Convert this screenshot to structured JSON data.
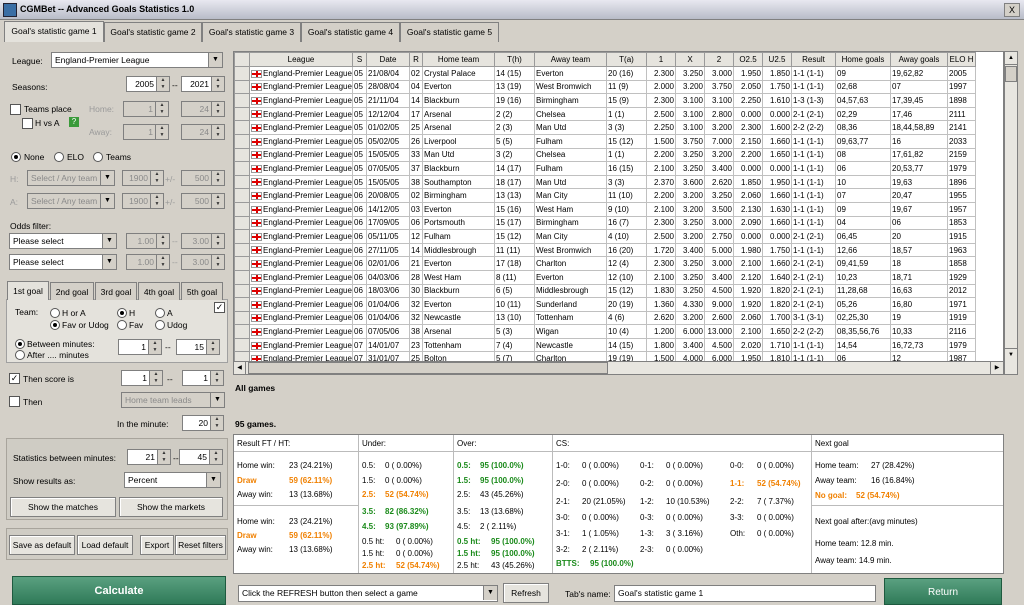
{
  "window": {
    "title": "CGMBet  -- Advanced Goals Statistics 1.0",
    "close_label": "X"
  },
  "tabs": [
    "Goal's statistic game 1",
    "Goal's statistic game 2",
    "Goal's statistic game 3",
    "Goal's statistic game 4",
    "Goal's statistic game 5"
  ],
  "left": {
    "league_label": "League:",
    "league_value": "England-Premier League",
    "seasons_label": "Seasons:",
    "season_from": "2005",
    "season_to": "2021",
    "dash": "--",
    "teams_place_label": "Teams place",
    "hvsa_label": "H vs A",
    "help_label": "?",
    "home_label": "Home:",
    "away_label": "Away:",
    "home_from": "1",
    "home_to": "24",
    "away_from": "1",
    "away_to": "24",
    "rating_none": "None",
    "rating_elo": "ELO",
    "rating_teams": "Teams",
    "h_label": "H:",
    "a_label": "A:",
    "team_placeholder": "Select / Any team",
    "elo_h": "1900",
    "elo_h_pm": "500",
    "elo_a": "1900",
    "elo_a_pm": "500",
    "pm": "+/-",
    "odds_label": "Odds filter:",
    "odds_select1": "Please select",
    "odds_select2": "Please select",
    "odds1_from": "1.00",
    "odds1_to": "3.00",
    "odds2_from": "1.00",
    "odds2_to": "3.00",
    "goal_tabs": [
      "1st goal",
      "2nd goal",
      "3rd goal",
      "4th goal",
      "5th goal"
    ],
    "team_label": "Team:",
    "team_hora": "H or A",
    "team_h": "H",
    "team_a": "A",
    "team_fav_udog": "Fav or Udog",
    "team_fav": "Fav",
    "team_udog": "Udog",
    "between_label": "Between minutes:",
    "after_label": "After .... minutes",
    "between_from": "1",
    "between_to": "15",
    "then_score_label": "Then score is",
    "score_home": "1",
    "score_away": "1",
    "score_sep": "--",
    "then_label": "Then",
    "then_value": "Home team leads",
    "in_minute_label": "In the minute:",
    "in_minute_value": "20",
    "stats_between_label": "Statistics between minutes:",
    "stats_from": "21",
    "stats_to": "45",
    "show_results_label": "Show results as:",
    "show_results_value": "Percent",
    "show_matches": "Show the matches",
    "show_markets": "Show the markets",
    "save_default": "Save as default",
    "load_default": "Load default",
    "export": "Export",
    "reset": "Reset filters",
    "calculate": "Calculate"
  },
  "grid": {
    "columns": [
      "League",
      "S",
      "Date",
      "R",
      "Home team",
      "T(h)",
      "Away team",
      "T(a)",
      "1",
      "X",
      "2",
      "O2.5",
      "U2.5",
      "Result",
      "Home goals",
      "Away goals",
      "ELO H"
    ],
    "rows": [
      [
        "England-Premier League",
        "05",
        "21/08/04",
        "02",
        "Crystal Palace",
        "14 (15)",
        "Everton",
        "20 (16)",
        "2.300",
        "3.250",
        "3.000",
        "1.950",
        "1.850",
        "1-1 (1-1)",
        "09",
        "19,62,82",
        "2005"
      ],
      [
        "England-Premier League",
        "05",
        "28/08/04",
        "04",
        "Everton",
        "13 (19)",
        "West Bromwich",
        "11 (9)",
        "2.000",
        "3.200",
        "3.750",
        "2.050",
        "1.750",
        "1-1 (1-1)",
        "02,68",
        "07",
        "1997"
      ],
      [
        "England-Premier League",
        "05",
        "21/11/04",
        "14",
        "Blackburn",
        "19 (16)",
        "Birmingham",
        "15 (9)",
        "2.300",
        "3.100",
        "3.100",
        "2.250",
        "1.610",
        "1-3 (1-3)",
        "04,57,63",
        "17,39,45",
        "1898"
      ],
      [
        "England-Premier League",
        "05",
        "12/12/04",
        "17",
        "Arsenal",
        "2 (2)",
        "Chelsea",
        "1 (1)",
        "2.500",
        "3.100",
        "2.800",
        "0.000",
        "0.000",
        "2-1 (2-1)",
        "02,29",
        "17,46",
        "2111"
      ],
      [
        "England-Premier League",
        "05",
        "01/02/05",
        "25",
        "Arsenal",
        "2 (3)",
        "Man Utd",
        "3 (3)",
        "2.250",
        "3.100",
        "3.200",
        "2.300",
        "1.600",
        "2-2 (2-2)",
        "08,36",
        "18,44,58,89",
        "2141"
      ],
      [
        "England-Premier League",
        "05",
        "05/02/05",
        "26",
        "Liverpool",
        "5 (5)",
        "Fulham",
        "15 (12)",
        "1.500",
        "3.750",
        "7.000",
        "2.150",
        "1.660",
        "1-1 (1-1)",
        "09,63,77",
        "16",
        "2033"
      ],
      [
        "England-Premier League",
        "05",
        "15/05/05",
        "33",
        "Man Utd",
        "3 (2)",
        "Chelsea",
        "1 (1)",
        "2.200",
        "3.250",
        "3.200",
        "2.200",
        "1.650",
        "1-1 (1-1)",
        "08",
        "17,61,82",
        "2159"
      ],
      [
        "England-Premier League",
        "05",
        "07/05/05",
        "37",
        "Blackburn",
        "14 (17)",
        "Fulham",
        "16 (15)",
        "2.100",
        "3.250",
        "3.400",
        "0.000",
        "0.000",
        "1-1 (1-1)",
        "06",
        "20,53,77",
        "1979"
      ],
      [
        "England-Premier League",
        "05",
        "15/05/05",
        "38",
        "Southampton",
        "18 (17)",
        "Man Utd",
        "3 (3)",
        "2.370",
        "3.600",
        "2.620",
        "1.850",
        "1.950",
        "1-1 (1-1)",
        "10",
        "19,63",
        "1896"
      ],
      [
        "England-Premier League",
        "06",
        "20/08/05",
        "02",
        "Birmingham",
        "13 (13)",
        "Man City",
        "11 (10)",
        "2.200",
        "3.200",
        "3.250",
        "2.060",
        "1.660",
        "1-1 (1-1)",
        "07",
        "20,47",
        "1955"
      ],
      [
        "England-Premier League",
        "06",
        "14/12/05",
        "03",
        "Everton",
        "15 (16)",
        "West Ham",
        "9 (10)",
        "2.100",
        "3.200",
        "3.500",
        "2.130",
        "1.630",
        "1-1 (1-1)",
        "09",
        "19,67",
        "1957"
      ],
      [
        "England-Premier League",
        "06",
        "17/09/05",
        "06",
        "Portsmouth",
        "15 (17)",
        "Birmingham",
        "16 (7)",
        "2.300",
        "3.250",
        "3.000",
        "2.090",
        "1.660",
        "1-1 (1-1)",
        "04",
        "06",
        "1853"
      ],
      [
        "England-Premier League",
        "06",
        "05/11/05",
        "12",
        "Fulham",
        "15 (12)",
        "Man City",
        "4 (10)",
        "2.500",
        "3.200",
        "2.750",
        "0.000",
        "0.000",
        "2-1 (2-1)",
        "06,45",
        "20",
        "1915"
      ],
      [
        "England-Premier League",
        "06",
        "27/11/05",
        "14",
        "Middlesbrough",
        "11 (11)",
        "West Bromwich",
        "16 (20)",
        "1.720",
        "3.400",
        "5.000",
        "1.980",
        "1.750",
        "1-1 (1-1)",
        "12,66",
        "18,57",
        "1963"
      ],
      [
        "England-Premier League",
        "06",
        "02/01/06",
        "21",
        "Everton",
        "17 (18)",
        "Charlton",
        "12 (4)",
        "2.300",
        "3.250",
        "3.000",
        "2.100",
        "1.660",
        "2-1 (2-1)",
        "09,41,59",
        "18",
        "1858"
      ],
      [
        "England-Premier League",
        "06",
        "04/03/06",
        "28",
        "West Ham",
        "8 (11)",
        "Everton",
        "12 (10)",
        "2.100",
        "3.250",
        "3.400",
        "2.120",
        "1.640",
        "2-1 (2-1)",
        "10,23",
        "18,71",
        "1929"
      ],
      [
        "England-Premier League",
        "06",
        "18/03/06",
        "30",
        "Blackburn",
        "6 (5)",
        "Middlesbrough",
        "15 (12)",
        "1.830",
        "3.250",
        "4.500",
        "1.920",
        "1.820",
        "2-1 (2-1)",
        "11,28,68",
        "16,63",
        "2012"
      ],
      [
        "England-Premier League",
        "06",
        "01/04/06",
        "32",
        "Everton",
        "10 (11)",
        "Sunderland",
        "20 (19)",
        "1.360",
        "4.330",
        "9.000",
        "1.920",
        "1.820",
        "2-1 (2-1)",
        "05,26",
        "16,80",
        "1971"
      ],
      [
        "England-Premier League",
        "06",
        "01/04/06",
        "32",
        "Newcastle",
        "13 (10)",
        "Tottenham",
        "4 (6)",
        "2.620",
        "3.200",
        "2.600",
        "2.060",
        "1.700",
        "3-1 (3-1)",
        "02,25,30",
        "19",
        "1919"
      ],
      [
        "England-Premier League",
        "06",
        "07/05/06",
        "38",
        "Arsenal",
        "5 (3)",
        "Wigan",
        "10 (4)",
        "1.200",
        "6.000",
        "13.000",
        "2.100",
        "1.650",
        "2-2 (2-2)",
        "08,35,56,76",
        "10,33",
        "2116"
      ],
      [
        "England-Premier League",
        "07",
        "14/01/07",
        "23",
        "Tottenham",
        "7 (4)",
        "Newcastle",
        "14 (15)",
        "1.800",
        "3.400",
        "4.500",
        "2.020",
        "1.710",
        "1-1 (1-1)",
        "14,54",
        "16,72,73",
        "1979"
      ],
      [
        "England-Premier League",
        "07",
        "31/01/07",
        "25",
        "Bolton",
        "5 (7)",
        "Charlton",
        "19 (19)",
        "1.500",
        "4.000",
        "6.000",
        "1.950",
        "1.810",
        "1-1 (1-1)",
        "06",
        "12",
        "1987"
      ]
    ]
  },
  "summary": {
    "all_games": "All games",
    "games_count": "95 games."
  },
  "stats": {
    "ft_ht_header": "Result FT / HT:",
    "home_win": "Home win:",
    "home_win_val": "23 (24.21%)",
    "draw": "Draw",
    "draw_val": "59 (62.11%)",
    "away_win": "Away win:",
    "away_win_val": "13 (13.68%)",
    "home_win_ht_val": "23 (24.21%)",
    "draw_ht_val": "59 (62.11%)",
    "away_win_ht_val": "13 (13.68%)",
    "under_header": "Under:",
    "under": [
      [
        "0.5:",
        "0 ( 0.00%)"
      ],
      [
        "1.5:",
        "0 ( 0.00%)"
      ],
      [
        "2.5:",
        "52 (54.74%)"
      ],
      [
        "3.5:",
        "82 (86.32%)"
      ],
      [
        "4.5:",
        "93 (97.89%)"
      ]
    ],
    "under_ht": [
      [
        "0.5 ht:",
        "0 ( 0.00%)"
      ],
      [
        "1.5 ht:",
        "0 ( 0.00%)"
      ],
      [
        "2.5 ht:",
        "52 (54.74%)"
      ]
    ],
    "over_header": "Over:",
    "over": [
      [
        "0.5:",
        "95 (100.0%)"
      ],
      [
        "1.5:",
        "95 (100.0%)"
      ],
      [
        "2.5:",
        "43 (45.26%)"
      ],
      [
        "3.5:",
        "13 (13.68%)"
      ],
      [
        "4.5:",
        "2 ( 2.11%)"
      ]
    ],
    "over_ht": [
      [
        "0.5 ht:",
        "95 (100.0%)"
      ],
      [
        "1.5 ht:",
        "95 (100.0%)"
      ],
      [
        "2.5 ht:",
        "43 (45.26%)"
      ]
    ],
    "cs_header": "CS:",
    "cs_col1": [
      [
        "1-0:",
        "0 ( 0.00%)"
      ],
      [
        "2-0:",
        "0 ( 0.00%)"
      ],
      [
        "2-1:",
        "20 (21.05%)"
      ],
      [
        "3-0:",
        "0 ( 0.00%)"
      ],
      [
        "3-1:",
        "1 ( 1.05%)"
      ],
      [
        "3-2:",
        "2 ( 2.11%)"
      ]
    ],
    "cs_col2": [
      [
        "0-1:",
        "0 ( 0.00%)"
      ],
      [
        "0-2:",
        "0 ( 0.00%)"
      ],
      [
        "1-2:",
        "10 (10.53%)"
      ],
      [
        "0-3:",
        "0 ( 0.00%)"
      ],
      [
        "1-3:",
        "3 ( 3.16%)"
      ],
      [
        "2-3:",
        "0 ( 0.00%)"
      ]
    ],
    "cs_col3": [
      [
        "0-0:",
        "0 ( 0.00%)"
      ],
      [
        "1-1:",
        "52 (54.74%)"
      ],
      [
        "2-2:",
        "7 ( 7.37%)"
      ],
      [
        "3-3:",
        "0 ( 0.00%)"
      ],
      [
        "Oth:",
        "0 ( 0.00%)"
      ]
    ],
    "btts": "BTTS:",
    "btts_val": "95 (100.0%)",
    "next_goal_header": "Next goal",
    "ng_home": "Home team:",
    "ng_home_val": "27 (28.42%)",
    "ng_away": "Away team:",
    "ng_away_val": "16 (16.84%)",
    "ng_none": "No goal:",
    "ng_none_val": "52 (54.74%)",
    "ng_after_header": "Next goal after:(avg minutes)",
    "ng_after_home": "Home team: 12.8 min.",
    "ng_after_away": "Away team: 14.9 min."
  },
  "bottom": {
    "refresh_select": "Click the REFRESH button then select a game",
    "refresh": "Refresh",
    "tab_name_label": "Tab's name:",
    "tab_name_value": "Goal's statistic game 1",
    "return": "Return"
  },
  "colors": {
    "accent_green": "#2f7a58",
    "highlight_orange": "#f08000",
    "success_green": "#1a8a1a"
  }
}
